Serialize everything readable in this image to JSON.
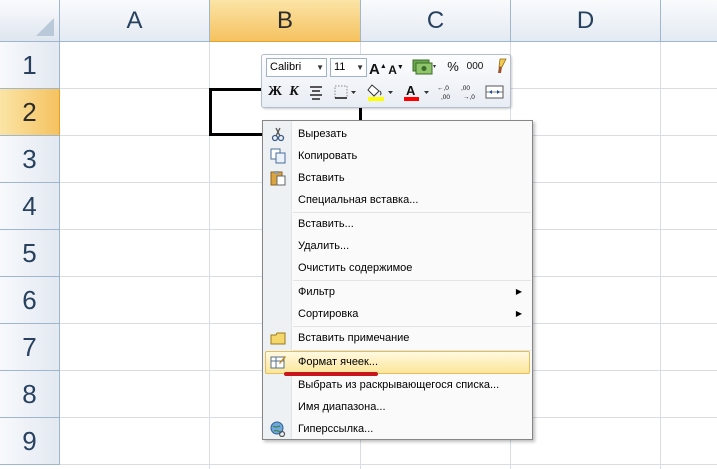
{
  "columns": [
    "A",
    "B",
    "C",
    "D"
  ],
  "selected_column": "B",
  "rows": [
    "1",
    "2",
    "3",
    "4",
    "5",
    "6",
    "7",
    "8",
    "9"
  ],
  "selected_row": "2",
  "mini_toolbar": {
    "font_name": "Calibri",
    "font_size": "11",
    "grow_font": "A",
    "shrink_font": "A",
    "percent": "%",
    "thousands": "000",
    "bold": "Ж",
    "italic": "К",
    "font_color_glyph": "A",
    "inc_decimal": "←,0 ,00",
    "dec_decimal": ",00 →,0"
  },
  "context_menu": {
    "cut": "Вырезать",
    "copy": "Копировать",
    "paste": "Вставить",
    "paste_special": "Специальная вставка...",
    "insert": "Вставить...",
    "delete": "Удалить...",
    "clear_contents": "Очистить содержимое",
    "filter": "Фильтр",
    "sort": "Сортировка",
    "insert_comment": "Вставить примечание",
    "format_cells": "Формат ячеек...",
    "pick_from_list": "Выбрать из раскрывающегося списка...",
    "name_range": "Имя диапазона...",
    "hyperlink": "Гиперссылка..."
  },
  "colors": {
    "selected_header": "#f5c260",
    "highlight_item": "#fce69a",
    "annotation_underline": "#c8161d",
    "fill_color": "#ffff00",
    "font_color": "#ff0000"
  }
}
